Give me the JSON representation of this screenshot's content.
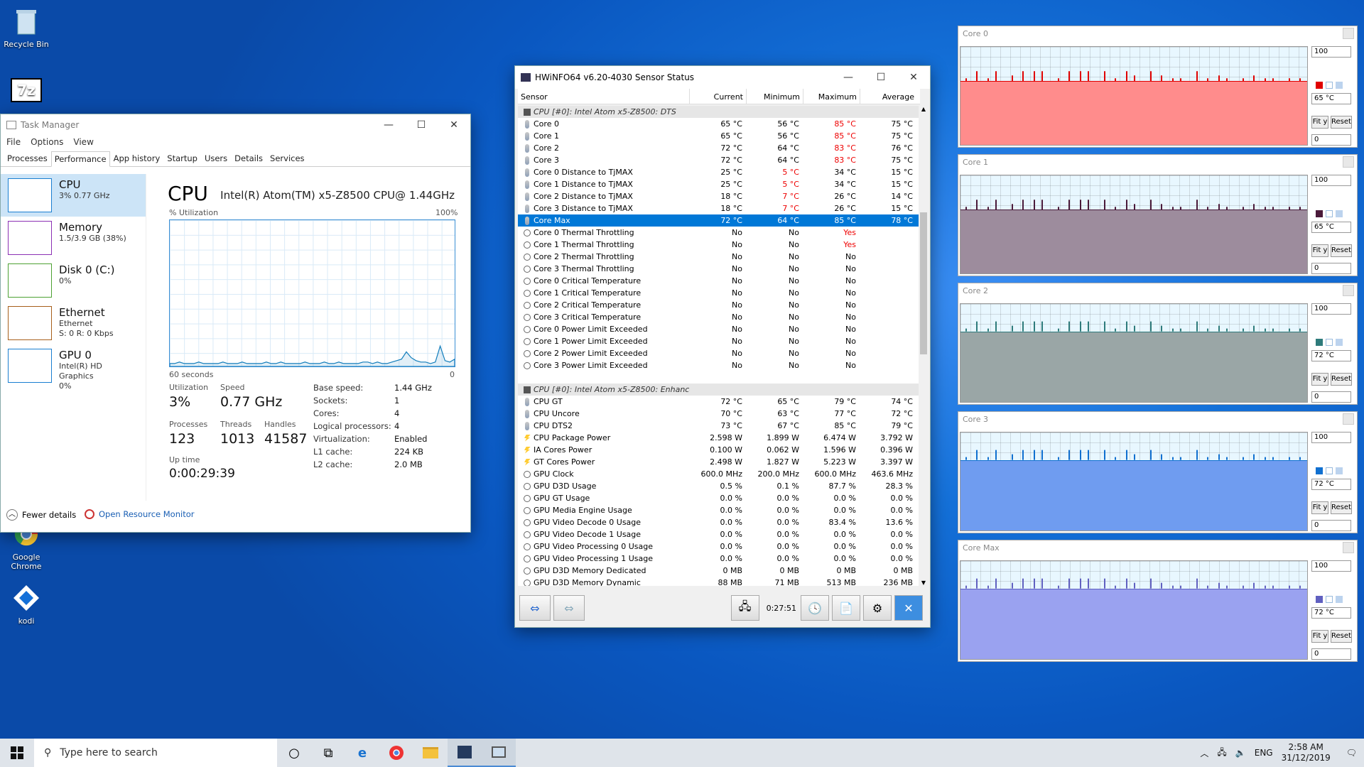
{
  "desktop": {
    "icons": [
      "Recycle Bin",
      "Google Chrome",
      "kodi"
    ]
  },
  "taskmanager": {
    "title": "Task Manager",
    "menu": [
      "File",
      "Options",
      "View"
    ],
    "tabs": [
      "Processes",
      "Performance",
      "App history",
      "Startup",
      "Users",
      "Details",
      "Services"
    ],
    "side": [
      {
        "name": "CPU",
        "sub1": "3% 0.77 GHz",
        "sub2": "",
        "sub3": ""
      },
      {
        "name": "Memory",
        "sub1": "1.5/3.9 GB (38%)",
        "sub2": "",
        "sub3": ""
      },
      {
        "name": "Disk 0 (C:)",
        "sub1": "0%",
        "sub2": "",
        "sub3": ""
      },
      {
        "name": "Ethernet",
        "sub1": "Ethernet",
        "sub2": "S: 0 R: 0 Kbps",
        "sub3": ""
      },
      {
        "name": "GPU 0",
        "sub1": "Intel(R) HD Graphics",
        "sub2": "0%",
        "sub3": ""
      }
    ],
    "heading": "CPU",
    "model": "Intel(R) Atom(TM) x5-Z8500 CPU@ 1.44GHz",
    "util_label": "% Utilization",
    "util_max": "100%",
    "time_label": "60 seconds",
    "time_min": "0",
    "utilization_label": "Utilization",
    "utilization": "3%",
    "speed_label": "Speed",
    "speed": "0.77 GHz",
    "processes_label": "Processes",
    "processes": "123",
    "threads_label": "Threads",
    "threads": "1013",
    "handles_label": "Handles",
    "handles": "41587",
    "uptime_label": "Up time",
    "uptime": "0:00:29:39",
    "specs": [
      [
        "Base speed:",
        "1.44 GHz"
      ],
      [
        "Sockets:",
        "1"
      ],
      [
        "Cores:",
        "4"
      ],
      [
        "Logical processors:",
        "4"
      ],
      [
        "Virtualization:",
        "Enabled"
      ],
      [
        "L1 cache:",
        "224 KB"
      ],
      [
        "L2 cache:",
        "2.0 MB"
      ]
    ],
    "fewer": "Fewer details",
    "resmon": "Open Resource Monitor",
    "graph": [
      2,
      2,
      3,
      2,
      2,
      2,
      3,
      2,
      2,
      2,
      2,
      3,
      2,
      2,
      2,
      3,
      2,
      2,
      2,
      2,
      3,
      2,
      2,
      3,
      2,
      2,
      2,
      2,
      3,
      2,
      2,
      2,
      3,
      2,
      2,
      3,
      2,
      2,
      2,
      2,
      3,
      3,
      2,
      3,
      2,
      2,
      3,
      4,
      5,
      10,
      6,
      4,
      3,
      3,
      2,
      3,
      14,
      4,
      3,
      5
    ]
  },
  "hwinfo": {
    "title": "HWiNFO64 v6.20-4030 Sensor Status",
    "headers": [
      "Sensor",
      "Current",
      "Minimum",
      "Maximum",
      "Average"
    ],
    "rows": [
      {
        "t": "grp",
        "n": "CPU [#0]: Intel Atom x5-Z8500: DTS"
      },
      {
        "i": "t",
        "n": "Core 0",
        "v": [
          "65 °C",
          "56 °C",
          "85 °C",
          "75 °C"
        ],
        "r": [
          2
        ]
      },
      {
        "i": "t",
        "n": "Core 1",
        "v": [
          "65 °C",
          "56 °C",
          "85 °C",
          "75 °C"
        ],
        "r": [
          2
        ]
      },
      {
        "i": "t",
        "n": "Core 2",
        "v": [
          "72 °C",
          "64 °C",
          "83 °C",
          "76 °C"
        ],
        "r": [
          2
        ]
      },
      {
        "i": "t",
        "n": "Core 3",
        "v": [
          "72 °C",
          "64 °C",
          "83 °C",
          "75 °C"
        ],
        "r": [
          2
        ]
      },
      {
        "i": "t",
        "n": "Core 0 Distance to TjMAX",
        "v": [
          "25 °C",
          "5 °C",
          "34 °C",
          "15 °C"
        ],
        "r": [
          1
        ]
      },
      {
        "i": "t",
        "n": "Core 1 Distance to TjMAX",
        "v": [
          "25 °C",
          "5 °C",
          "34 °C",
          "15 °C"
        ],
        "r": [
          1
        ]
      },
      {
        "i": "t",
        "n": "Core 2 Distance to TjMAX",
        "v": [
          "18 °C",
          "7 °C",
          "26 °C",
          "14 °C"
        ],
        "r": [
          1
        ]
      },
      {
        "i": "t",
        "n": "Core 3 Distance to TjMAX",
        "v": [
          "18 °C",
          "7 °C",
          "26 °C",
          "15 °C"
        ],
        "r": [
          1
        ]
      },
      {
        "t": "sel",
        "i": "t",
        "n": "Core Max",
        "v": [
          "72 °C",
          "64 °C",
          "85 °C",
          "78 °C"
        ]
      },
      {
        "i": "o",
        "n": "Core 0 Thermal Throttling",
        "v": [
          "No",
          "No",
          "Yes",
          ""
        ],
        "r": [
          2
        ]
      },
      {
        "i": "o",
        "n": "Core 1 Thermal Throttling",
        "v": [
          "No",
          "No",
          "Yes",
          ""
        ],
        "r": [
          2
        ]
      },
      {
        "i": "o",
        "n": "Core 2 Thermal Throttling",
        "v": [
          "No",
          "No",
          "No",
          ""
        ]
      },
      {
        "i": "o",
        "n": "Core 3 Thermal Throttling",
        "v": [
          "No",
          "No",
          "No",
          ""
        ]
      },
      {
        "i": "o",
        "n": "Core 0 Critical Temperature",
        "v": [
          "No",
          "No",
          "No",
          ""
        ]
      },
      {
        "i": "o",
        "n": "Core 1 Critical Temperature",
        "v": [
          "No",
          "No",
          "No",
          ""
        ]
      },
      {
        "i": "o",
        "n": "Core 2 Critical Temperature",
        "v": [
          "No",
          "No",
          "No",
          ""
        ]
      },
      {
        "i": "o",
        "n": "Core 3 Critical Temperature",
        "v": [
          "No",
          "No",
          "No",
          ""
        ]
      },
      {
        "i": "o",
        "n": "Core 0 Power Limit Exceeded",
        "v": [
          "No",
          "No",
          "No",
          ""
        ]
      },
      {
        "i": "o",
        "n": "Core 1 Power Limit Exceeded",
        "v": [
          "No",
          "No",
          "No",
          ""
        ]
      },
      {
        "i": "o",
        "n": "Core 2 Power Limit Exceeded",
        "v": [
          "No",
          "No",
          "No",
          ""
        ]
      },
      {
        "i": "o",
        "n": "Core 3 Power Limit Exceeded",
        "v": [
          "No",
          "No",
          "No",
          ""
        ]
      },
      {
        "t": "gap"
      },
      {
        "t": "grp",
        "n": "CPU [#0]: Intel Atom x5-Z8500: Enhanced"
      },
      {
        "i": "t",
        "n": "CPU GT",
        "v": [
          "72 °C",
          "65 °C",
          "79 °C",
          "74 °C"
        ]
      },
      {
        "i": "t",
        "n": "CPU Uncore",
        "v": [
          "70 °C",
          "63 °C",
          "77 °C",
          "72 °C"
        ]
      },
      {
        "i": "t",
        "n": "CPU DTS2",
        "v": [
          "73 °C",
          "67 °C",
          "85 °C",
          "79 °C"
        ]
      },
      {
        "i": "b",
        "n": "CPU Package Power",
        "v": [
          "2.598 W",
          "1.899 W",
          "6.474 W",
          "3.792 W"
        ]
      },
      {
        "i": "b",
        "n": "IA Cores Power",
        "v": [
          "0.100 W",
          "0.062 W",
          "1.596 W",
          "0.396 W"
        ]
      },
      {
        "i": "b",
        "n": "GT Cores Power",
        "v": [
          "2.498 W",
          "1.827 W",
          "5.223 W",
          "3.397 W"
        ]
      },
      {
        "i": "o",
        "n": "GPU Clock",
        "v": [
          "600.0 MHz",
          "200.0 MHz",
          "600.0 MHz",
          "463.6 MHz"
        ]
      },
      {
        "i": "o",
        "n": "GPU D3D Usage",
        "v": [
          "0.5 %",
          "0.1 %",
          "87.7 %",
          "28.3 %"
        ]
      },
      {
        "i": "o",
        "n": "GPU GT Usage",
        "v": [
          "0.0 %",
          "0.0 %",
          "0.0 %",
          "0.0 %"
        ]
      },
      {
        "i": "o",
        "n": "GPU Media Engine Usage",
        "v": [
          "0.0 %",
          "0.0 %",
          "0.0 %",
          "0.0 %"
        ]
      },
      {
        "i": "o",
        "n": "GPU Video Decode 0 Usage",
        "v": [
          "0.0 %",
          "0.0 %",
          "83.4 %",
          "13.6 %"
        ]
      },
      {
        "i": "o",
        "n": "GPU Video Decode 1 Usage",
        "v": [
          "0.0 %",
          "0.0 %",
          "0.0 %",
          "0.0 %"
        ]
      },
      {
        "i": "o",
        "n": "GPU Video Processing 0 Usage",
        "v": [
          "0.0 %",
          "0.0 %",
          "0.0 %",
          "0.0 %"
        ]
      },
      {
        "i": "o",
        "n": "GPU Video Processing 1 Usage",
        "v": [
          "0.0 %",
          "0.0 %",
          "0.0 %",
          "0.0 %"
        ]
      },
      {
        "i": "o",
        "n": "GPU D3D Memory Dedicated",
        "v": [
          "0 MB",
          "0 MB",
          "0 MB",
          "0 MB"
        ]
      },
      {
        "i": "o",
        "n": "GPU D3D Memory Dynamic",
        "v": [
          "88 MB",
          "71 MB",
          "513 MB",
          "236 MB"
        ]
      }
    ],
    "elapsed": "0:27:51"
  },
  "graphs": [
    {
      "title": "Core 0",
      "top": "100",
      "cur": "65 °C",
      "bottom": "0",
      "color": "#ff8c8c",
      "line": "#e00000",
      "level": 0.65
    },
    {
      "title": "Core 1",
      "top": "100",
      "cur": "65 °C",
      "bottom": "0",
      "color": "#9d8c9d",
      "line": "#4a1a3a",
      "level": 0.65
    },
    {
      "title": "Core 2",
      "top": "100",
      "cur": "72 °C",
      "bottom": "0",
      "color": "#9aa6a6",
      "line": "#2e7b7b",
      "level": 0.72
    },
    {
      "title": "Core 3",
      "top": "100",
      "cur": "72 °C",
      "bottom": "0",
      "color": "#6f9cf0",
      "line": "#1070d0",
      "level": 0.72
    },
    {
      "title": "Core Max",
      "top": "100",
      "cur": "72 °C",
      "bottom": "0",
      "color": "#9aa2f0",
      "line": "#6060c0",
      "level": 0.72
    }
  ],
  "graph_buttons": [
    "Fit y",
    "Reset"
  ],
  "taskbar": {
    "search": "Type here to search",
    "lang": "ENG",
    "time": "2:58 AM",
    "date": "31/12/2019"
  }
}
